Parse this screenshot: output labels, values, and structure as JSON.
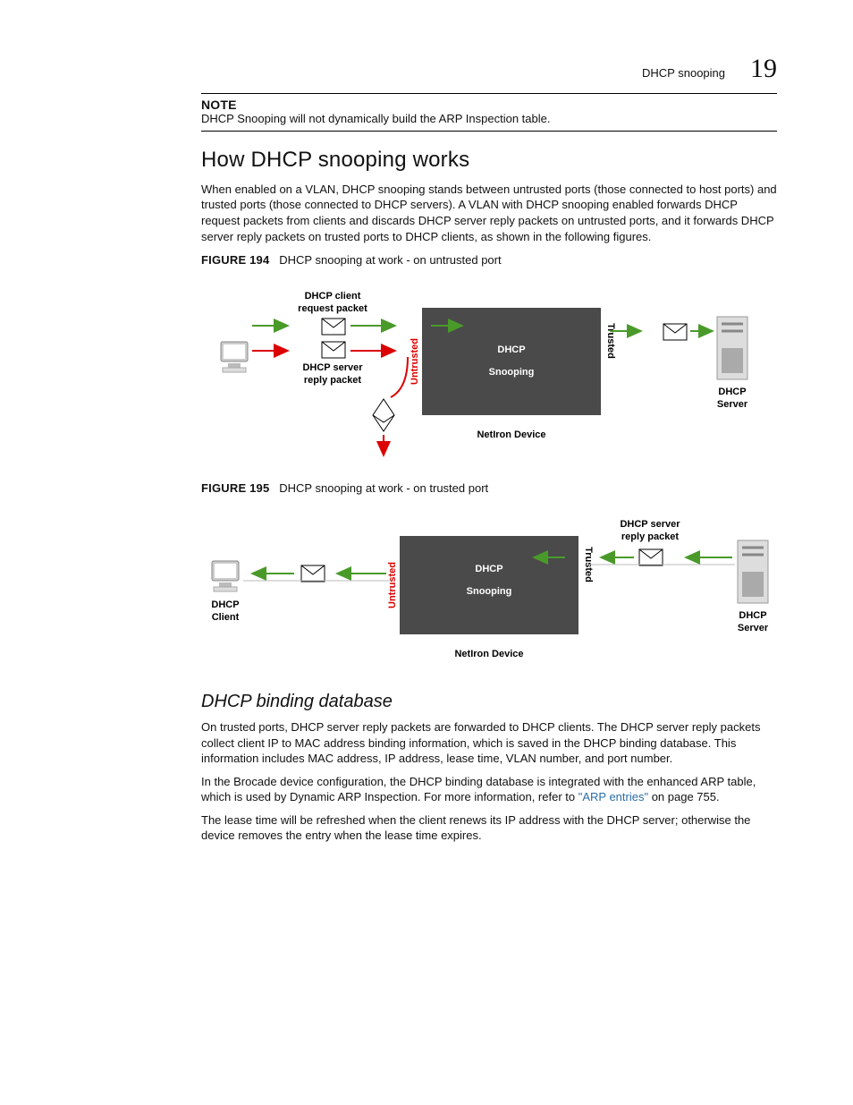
{
  "header": {
    "topic": "DHCP snooping",
    "page_number": "19"
  },
  "note": {
    "label": "NOTE",
    "text": "DHCP Snooping will not dynamically build the ARP Inspection table."
  },
  "section": {
    "title": "How DHCP snooping works",
    "intro": "When enabled on a VLAN, DHCP snooping stands between untrusted ports (those connected to host ports) and trusted ports (those connected to DHCP servers). A VLAN with DHCP snooping enabled forwards DHCP request packets from clients and discards DHCP server reply packets on untrusted ports, and it forwards DHCP server reply packets on trusted ports to DHCP clients, as shown in the following figures."
  },
  "figure1": {
    "label": "FIGURE 194",
    "caption": "DHCP snooping at work - on untrusted port",
    "labels": {
      "client_request": "DHCP client",
      "client_request2": "request packet",
      "server_reply": "DHCP server",
      "server_reply2": "reply packet",
      "untrusted": "Untrusted",
      "trusted": "Trusted",
      "box_line1": "DHCP",
      "box_line2": "Snooping",
      "device": "NetIron Device",
      "server": "DHCP",
      "server2": "Server"
    }
  },
  "figure2": {
    "label": "FIGURE 195",
    "caption": "DHCP snooping at work - on trusted port",
    "labels": {
      "client": "DHCP",
      "client2": "Client",
      "server_reply": "DHCP server",
      "server_reply2": "reply packet",
      "untrusted": "Untrusted",
      "trusted": "Trusted",
      "box_line1": "DHCP",
      "box_line2": "Snooping",
      "device": "NetIron Device",
      "server": "DHCP",
      "server2": "Server"
    }
  },
  "subsection": {
    "title": "DHCP binding database",
    "p1": "On trusted ports, DHCP server reply packets are forwarded to DHCP clients. The DHCP server reply packets collect client IP to MAC address binding information, which is saved in the DHCP binding database. This information includes MAC address, IP address, lease time, VLAN number, and port number.",
    "p2a": "In the Brocade device configuration, the DHCP binding database is integrated with the enhanced ARP table, which is used by Dynamic ARP Inspection. For more information, refer to ",
    "p2_link": "\"ARP entries\"",
    "p2b": " on page 755.",
    "p3": "The lease time will be refreshed when the client renews its IP address with the DHCP server; otherwise the device removes the entry when the lease time expires."
  }
}
